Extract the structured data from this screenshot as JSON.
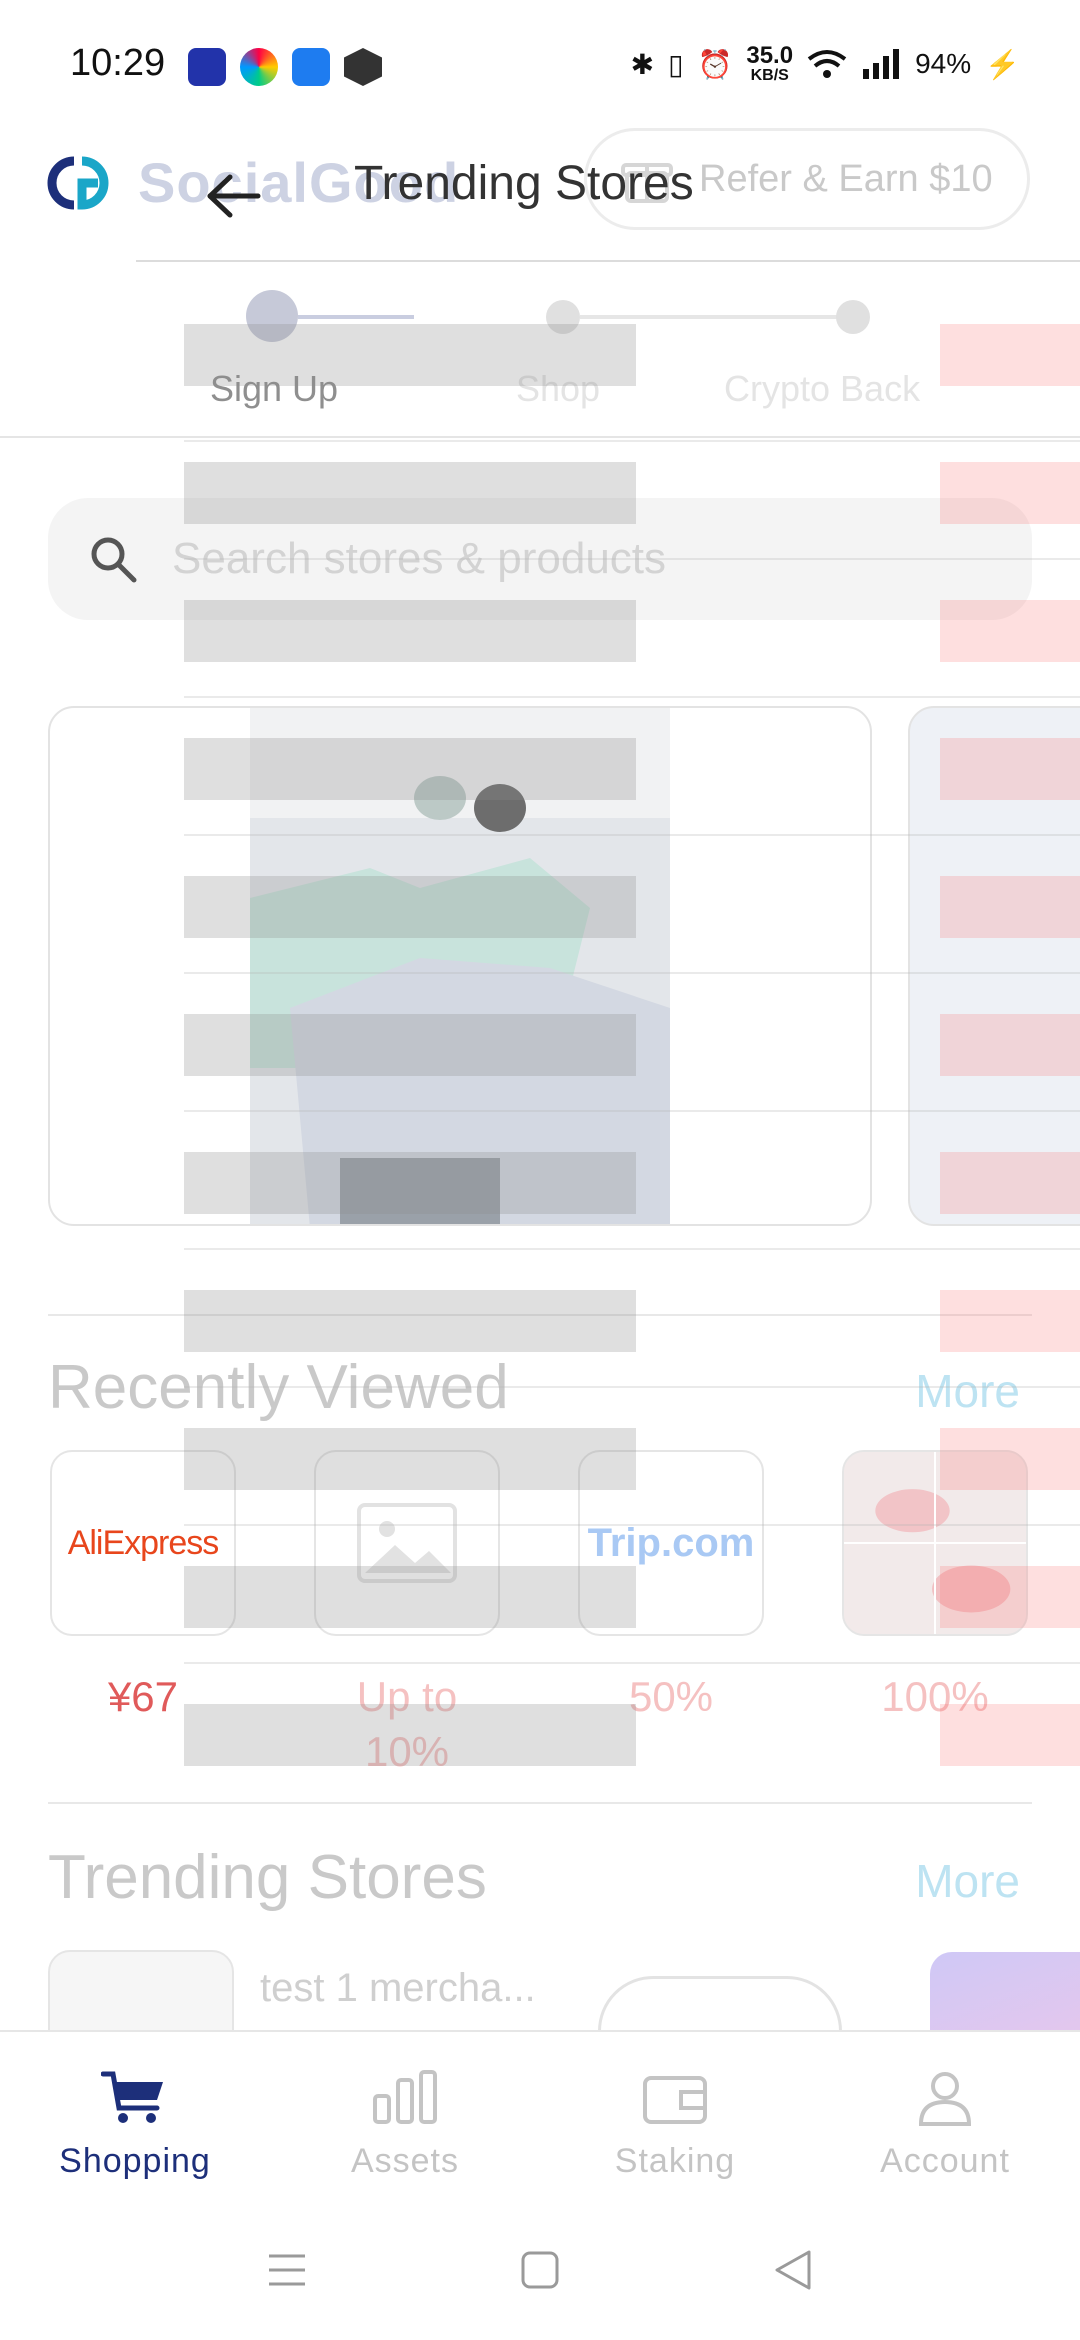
{
  "status_bar": {
    "time": "10:29",
    "speed_value": "35.0",
    "speed_unit": "KB/S",
    "battery": "94%"
  },
  "brand": {
    "name": "SocialGood",
    "logo_color": "#1d2f7a",
    "accent_color": "#1aa6c8"
  },
  "header": {
    "refer_label": "Refer & Earn $10"
  },
  "steps": [
    {
      "label": "Sign Up",
      "active": true
    },
    {
      "label": "Shop",
      "active": false
    },
    {
      "label": "Crypto Back",
      "active": false
    }
  ],
  "search": {
    "placeholder": "Search stores & products"
  },
  "recently_viewed": {
    "title": "Recently Viewed",
    "more": "More",
    "items": [
      {
        "store": "AliExpress",
        "value": "¥67"
      },
      {
        "store": "placeholder-image",
        "value": "Up to 10%"
      },
      {
        "store": "Trip.com",
        "value": "50%"
      },
      {
        "store": "cosmetics",
        "value": "100%"
      }
    ]
  },
  "trending": {
    "title": "Trending Stores",
    "more": "More",
    "first_store_name": "test 1 mercha..."
  },
  "overlay": {
    "title": "Trending Stores"
  },
  "bottom_nav": [
    {
      "label": "Shopping",
      "icon": "cart-icon",
      "active": true
    },
    {
      "label": "Assets",
      "icon": "bar-chart-icon",
      "active": false
    },
    {
      "label": "Staking",
      "icon": "wallet-icon",
      "active": false
    },
    {
      "label": "Account",
      "icon": "person-icon",
      "active": false
    }
  ]
}
